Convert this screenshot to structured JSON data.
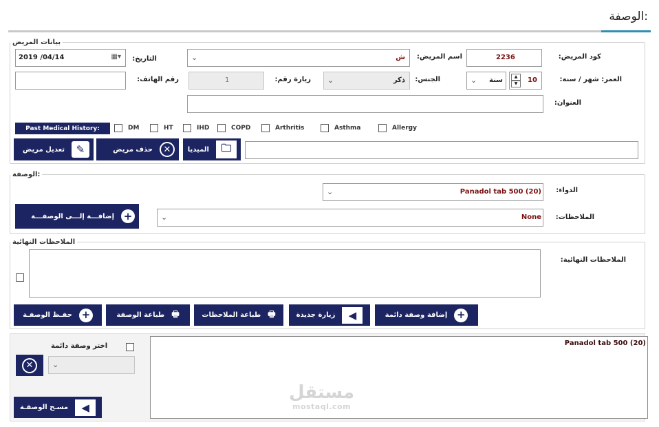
{
  "page_title": "الوصفة:",
  "patient_section": {
    "legend": "بيانات المريض",
    "patient_code_label": "كود المريض:",
    "patient_code_value": "2236",
    "patient_name_label": "اسم المريض:",
    "patient_name_value": "ش",
    "date_label": "التاريخ:",
    "date_value": "2019 /04/14",
    "age_label": "العمر: شهر / سنة:",
    "age_value": "10",
    "age_unit": "سنة",
    "gender_label": "الجنس:",
    "gender_value": "ذكر",
    "visit_label": "زيارة رقم:",
    "visit_value": "1",
    "phone_label": "رقم الهاتف:",
    "phone_value": "",
    "address_label": "العنوان:",
    "address_value": "",
    "pmh_label": "Past Medical History:",
    "conditions": [
      "DM",
      "HT",
      "IHD",
      "COPD",
      "Arthritis",
      "Asthma",
      "Allergy"
    ],
    "edit_button": "تعديل مريض",
    "delete_button": "حذف مريض",
    "media_button": "الميديا",
    "media_path": ""
  },
  "prescription_section": {
    "legend": "الوصفة:",
    "drug_label": "الدواء:",
    "drug_value": "Panadol tab 500 (20)",
    "notes_label": "الملاحظات:",
    "notes_value": "None",
    "add_button": "إضافـــة إلـــى الوصفـــة"
  },
  "final_notes_section": {
    "legend": "الملاحظات النهائية",
    "notes_label": "الملاحظات النهائية:",
    "notes_value": "",
    "save_button": "حفـظ الوصفـة",
    "print_prescription_button": "طباعة الوصفة",
    "print_notes_button": "طباعة الملاحظات",
    "new_visit_button": "زيارة جديدة",
    "add_permanent_button": "إضافة وصفة دائمة"
  },
  "bottom": {
    "choose_permanent_label": "اختر وصفة دائمة",
    "clear_button": "مسـح الوصفـة",
    "prescription_text": "Panadol tab 500 (20)"
  },
  "watermark": {
    "arabic": "مستقل",
    "latin": "mostaql.com"
  },
  "colors": {
    "button_bg": "#1c2461",
    "value_text": "#7a1010",
    "accent_line": "#2d8fb5"
  }
}
